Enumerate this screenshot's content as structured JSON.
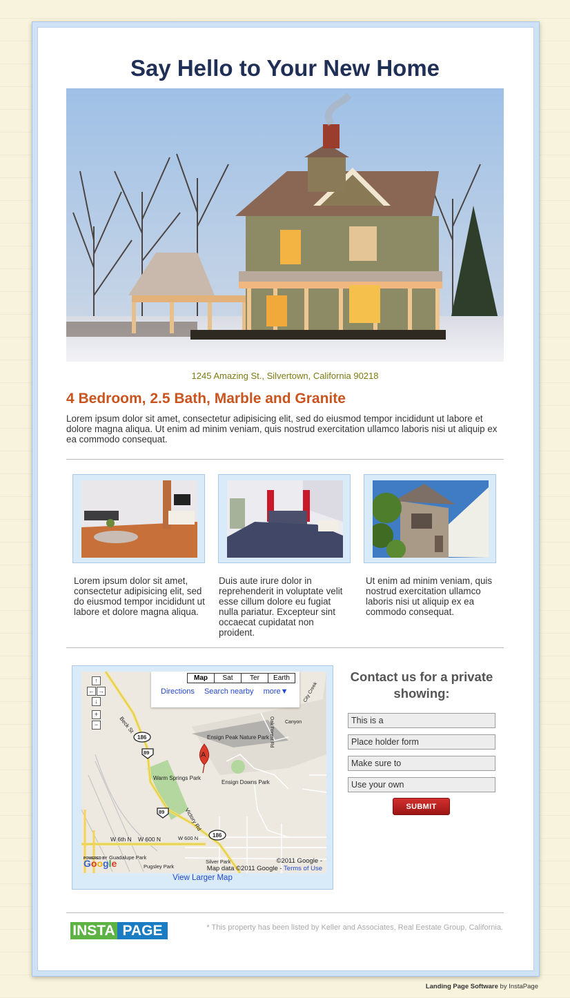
{
  "title": "Say Hello to Your New Home",
  "address": "1245 Amazing St., Silvertown, California 90218",
  "headline": "4 Bedroom, 2.5 Bath, Marble and Granite",
  "intro": "Lorem ipsum dolor sit amet, consectetur adipisicing elit, sed do eiusmod tempor incididunt ut labore et dolore magna aliqua. Ut enim ad minim veniam, quis nostrud exercitation ullamco laboris nisi ut aliquip ex ea commodo consequat.",
  "features": [
    {
      "caption": "Lorem ipsum dolor sit amet, consectetur adipisicing elit, sed do eiusmod tempor incididunt ut labore et dolore magna aliqua."
    },
    {
      "caption": "Duis aute irure dolor in reprehenderit in voluptate velit esse cillum dolore eu fugiat nulla pariatur. Excepteur sint occaecat cupidatat non proident."
    },
    {
      "caption": "Ut enim ad minim veniam, quis nostrud exercitation ullamco laboris nisi ut aliquip ex ea commodo consequat."
    }
  ],
  "map": {
    "tabs": [
      "Map",
      "Sat",
      "Ter",
      "Earth"
    ],
    "links": {
      "directions": "Directions",
      "search_nearby": "Search nearby",
      "more": "more▼"
    },
    "labels": {
      "beck_st": "Beck St",
      "route_186": "186",
      "route_89": "89",
      "ensign_peak": "Ensign Peak Nature Park",
      "warm_springs": "Warm Springs Park",
      "ensign_downs": "Ensign Downs Park",
      "victory_rd": "Victory Rd",
      "w6th": "W 6th N",
      "w600n": "W 600 N",
      "w600n2": "W 600 N",
      "guadalupe": "Guadalupe Park",
      "pugsley": "Pugsley Park",
      "silver_park": "Silver Park",
      "canyon": "Canyon",
      "city_creek": "City Creek",
      "oak_forest": "Oak Forest Rd",
      "marker": "A",
      "powered": "POWERED BY"
    },
    "copyright": "©2011 Google -",
    "map_data": "Map data ©2011 Google -",
    "terms": "Terms of Use",
    "view_larger": "View Larger Map"
  },
  "contact": {
    "title": "Contact us for a private showing:",
    "fields": [
      "This is a",
      "Place holder form",
      "Make sure to",
      "Use your own"
    ],
    "submit": "SUBMIT"
  },
  "logo": {
    "part1": "INSTA",
    "part2": "PAGE"
  },
  "disclaimer": "* This property has been listed by Keller and Associates, Real Eestate Group, California.",
  "footer": {
    "brand": "Landing Page Software",
    "by": " by InstaPage"
  },
  "colors": {
    "title": "#1f2f55",
    "headline": "#c9541e",
    "address": "#7a7b10",
    "submit": "#b8201e"
  }
}
